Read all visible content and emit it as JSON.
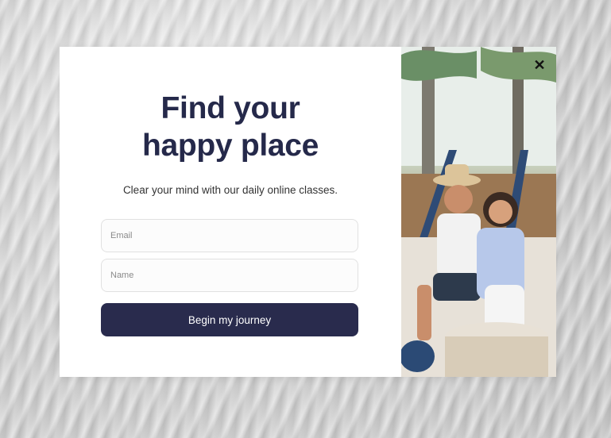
{
  "popup": {
    "headline_line1": "Find your",
    "headline_line2": "happy place",
    "subtitle": "Clear your mind with our daily online classes.",
    "email_placeholder": "Email",
    "name_placeholder": "Name",
    "cta_label": "Begin my journey",
    "close_icon": "close-icon",
    "colors": {
      "heading": "#25294a",
      "button": "#292b4d",
      "button_text": "#ffffff"
    }
  }
}
